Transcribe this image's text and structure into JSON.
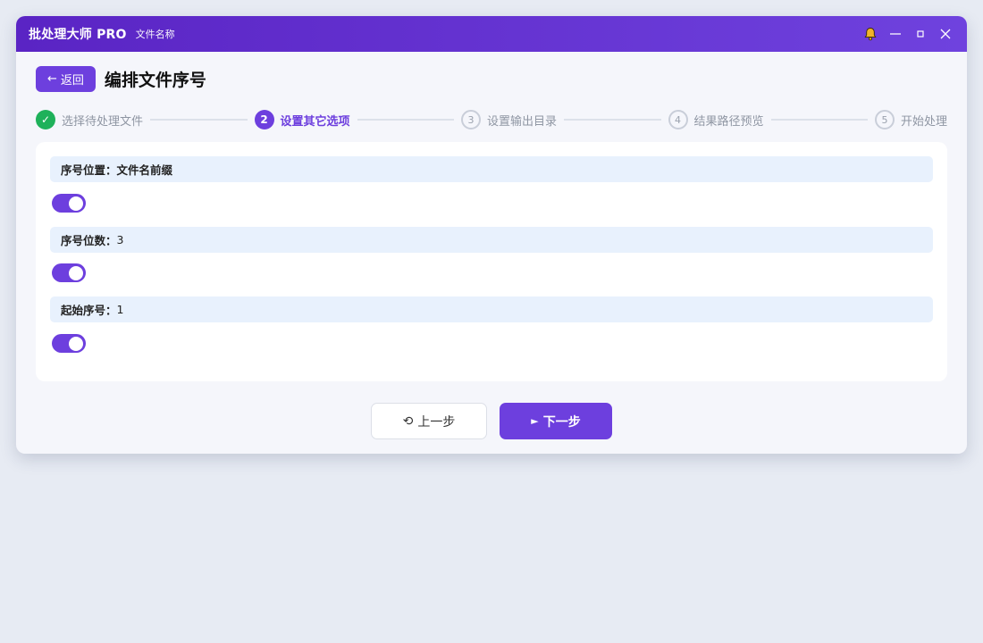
{
  "titlebar": {
    "app_title": "批处理大师 PRO",
    "file_name": "文件名称",
    "bell_icon_color": "#f0b429"
  },
  "header": {
    "back_label": "返回",
    "page_title": "编排文件序号"
  },
  "stepper": {
    "steps": [
      {
        "number": "✓",
        "label": "选择待处理文件",
        "state": "done"
      },
      {
        "number": "2",
        "label": "设置其它选项",
        "state": "active"
      },
      {
        "number": "3",
        "label": "设置输出目录",
        "state": "todo"
      },
      {
        "number": "4",
        "label": "结果路径预览",
        "state": "todo"
      },
      {
        "number": "5",
        "label": "开始处理",
        "state": "todo"
      }
    ]
  },
  "options": [
    {
      "label": "序号位置：",
      "value": "文件名前缀",
      "toggle_on": true
    },
    {
      "label": "序号位数：",
      "value": "3",
      "toggle_on": true
    },
    {
      "label": "起始序号：",
      "value": "1",
      "toggle_on": true
    }
  ],
  "footer": {
    "prev_label": "上一步",
    "next_label": "下一步"
  },
  "colors": {
    "accent": "#6d3fde",
    "done": "#1fb15a",
    "option_bg": "#e8f1fd"
  }
}
